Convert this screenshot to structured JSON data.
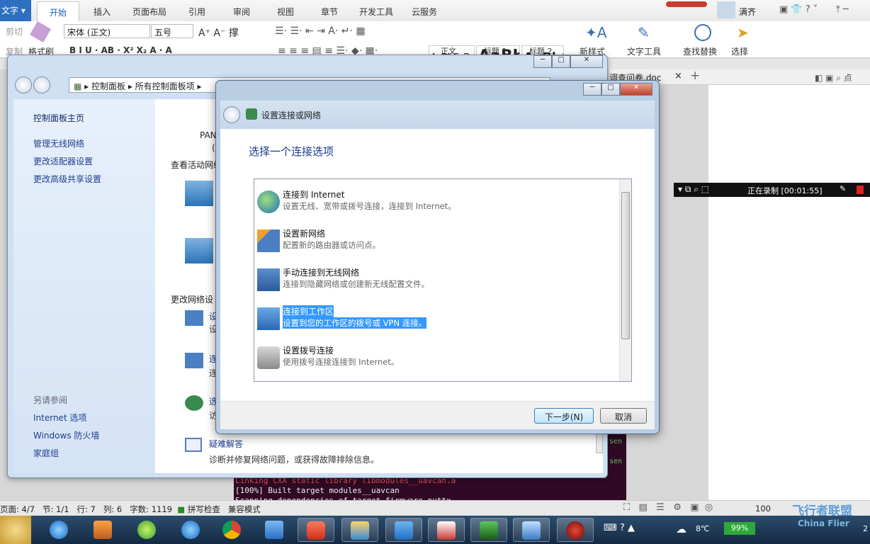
{
  "wps": {
    "mode_label": "文字",
    "tabs": [
      "开始",
      "插入",
      "页面布局",
      "引用",
      "审阅",
      "视图",
      "章节",
      "开发工具",
      "云服务"
    ],
    "user": "满齐",
    "clipboard": {
      "cut": "剪切",
      "copy": "复制",
      "format_painter": "格式刷"
    },
    "font_name": "宋体 (正文)",
    "font_size": "五号",
    "styles": [
      {
        "preview": "AaBbCcDd",
        "label": "正文"
      },
      {
        "preview": "AaBb",
        "label": "标题 1"
      },
      {
        "preview": "AaBb(",
        "label": "标题 2"
      }
    ],
    "new_style": "新样式",
    "text_tools": "文字工具",
    "find_replace": "查找替换",
    "select": "选择",
    "doc_tab": "调查问卷.doc",
    "doc_tab_close": "×",
    "doc_tab_add": "+"
  },
  "control_panel": {
    "breadcrumb": [
      "控制面板",
      "所有控制面板项"
    ],
    "left_links": [
      "控制面板主页",
      "管理无线网络",
      "更改适配器设置",
      "更改高级共享设置"
    ],
    "see_also_title": "另请参阅",
    "see_also": [
      "Internet 选项",
      "Windows 防火墙",
      "家庭组"
    ],
    "main_fragments": {
      "pan": "PAN",
      "paren": "(",
      "view_active": "查看活动网络",
      "change_settings": "更改网络设",
      "setting_frag": "设",
      "setting_frag2": "设",
      "conn_frag": "连",
      "conn_frag2": "连",
      "opt_frag": "选",
      "opt_frag2": "访"
    },
    "troubleshoot_title": "疑难解答",
    "troubleshoot_desc": "诊断并修复网络问题，或获得故障排除信息。"
  },
  "dialog": {
    "title": "设置连接或网络",
    "heading": "选择一个连接选项",
    "options": [
      {
        "title": "连接到 Internet",
        "desc": "设置无线、宽带或拨号连接，连接到 Internet。",
        "icon": "globe-icon",
        "selected": false
      },
      {
        "title": "设置新网络",
        "desc": "配置新的路由器或访问点。",
        "icon": "router-icon",
        "selected": false
      },
      {
        "title": "手动连接到无线网络",
        "desc": "连接到隐藏网络或创建新无线配置文件。",
        "icon": "wireless-icon",
        "selected": false
      },
      {
        "title": "连接到工作区",
        "desc": "设置到您的工作区的拨号或 VPN 连接。",
        "icon": "workplace-icon",
        "selected": true
      },
      {
        "title": "设置拨号连接",
        "desc": "使用拨号连接连接到 Internet。",
        "icon": "modem-icon",
        "selected": false
      }
    ],
    "next_button": "下一步(N)",
    "cancel_button": "取消"
  },
  "terminal": {
    "lines": [
      "Linking CXX static library libmodules__uavcan.a",
      "[100%] Built target modules__uavcan",
      "Scanning dependencies of target firmware_nuttx"
    ],
    "right_lines": [
      "sen",
      "sen"
    ]
  },
  "recorder": {
    "status": "正在录制 [00:01:55]"
  },
  "statusbar": {
    "page": "页面: 4/7",
    "section": "节: 1/1",
    "row": "行: 7",
    "col": "列: 6",
    "words": "字数: 1119",
    "spell": "拼写检查",
    "compat": "兼容模式",
    "zoom": "100"
  },
  "taskbar": {
    "temp": "8℃",
    "battery": "99%",
    "watermark": "飞行者联盟",
    "watermark_en": "China Flier",
    "clock_frag": "2"
  },
  "colors": {
    "accent": "#2f6fc2",
    "selection": "#3399ff",
    "link": "#1c3e8c",
    "terminal_bg": "#300a24",
    "terminal_red": "#e05050"
  }
}
